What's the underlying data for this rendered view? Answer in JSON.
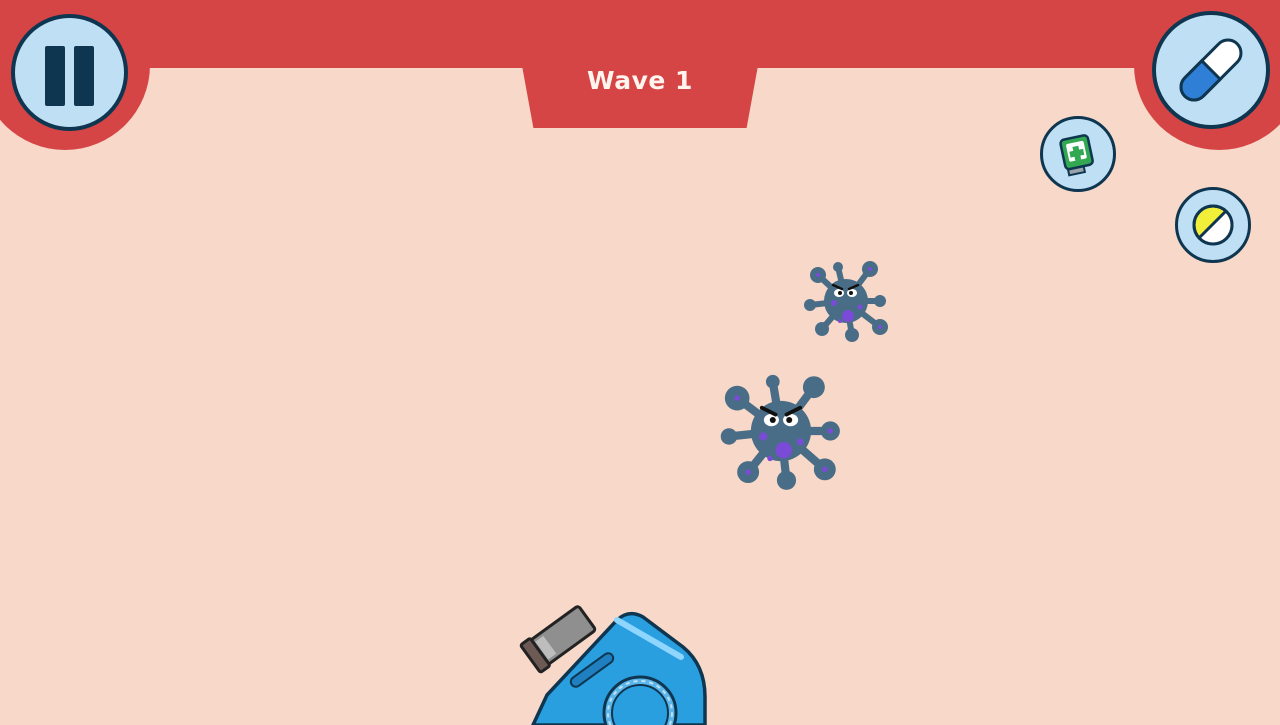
{
  "hud": {
    "wave_label": "Wave 1"
  },
  "icons": {
    "pause": "pause-icon",
    "capsule": "capsule-pill-icon",
    "first_aid_kit": "first-aid-kit-icon",
    "tablet": "tablet-pill-icon",
    "virus": "virus-icon",
    "cannon": "pill-cannon-icon"
  },
  "colors": {
    "hud_red": "#d64546",
    "background": "#f8d8c8",
    "button_fill": "#bfe0f4",
    "button_outline": "#0f3650",
    "virus_body": "#4a6d87",
    "virus_spot": "#7a4bd6",
    "cannon_blue": "#2a9fe0"
  },
  "enemies": [
    {
      "type": "virus"
    },
    {
      "type": "virus"
    }
  ]
}
